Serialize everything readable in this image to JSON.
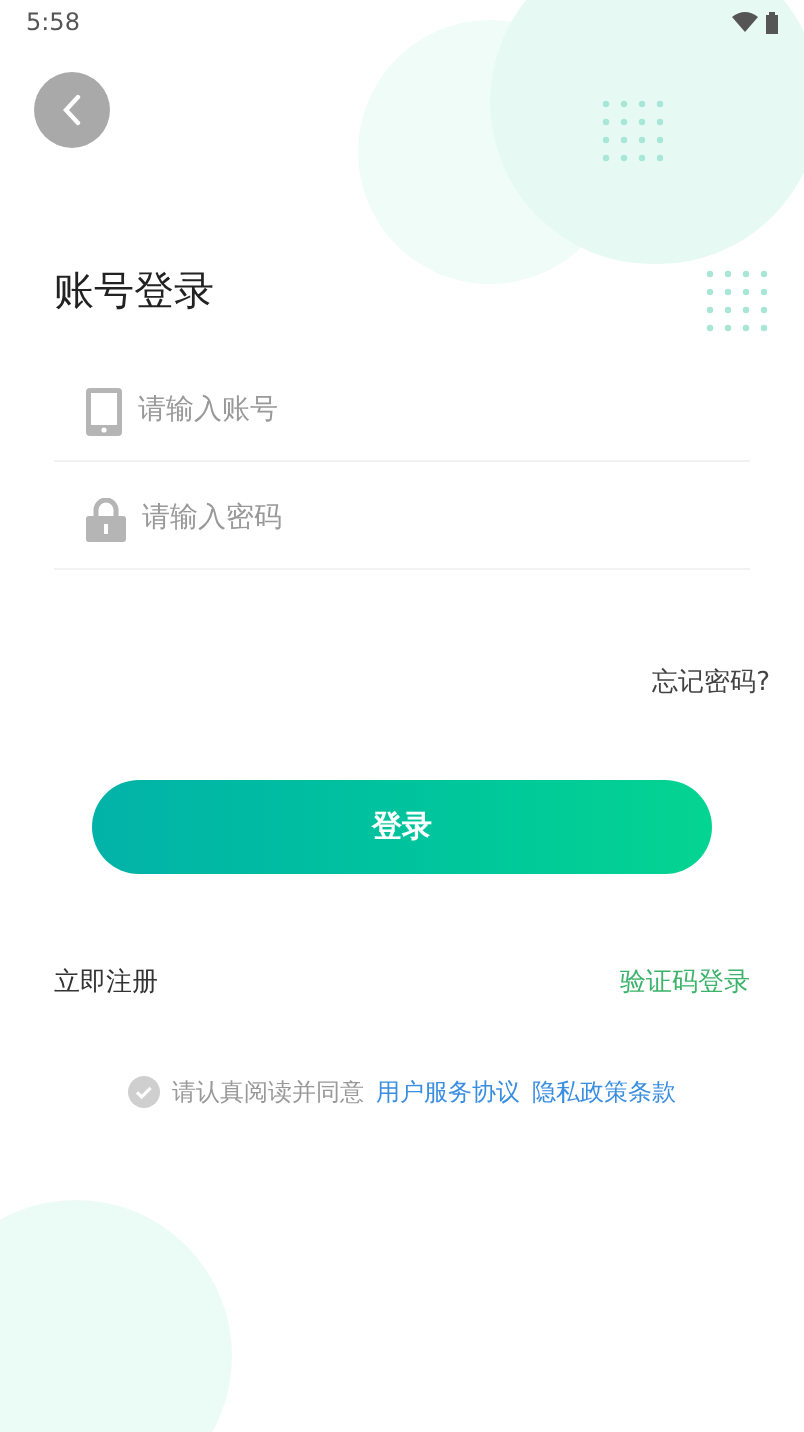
{
  "status_bar": {
    "time": "5:58"
  },
  "title": "账号登录",
  "fields": [
    {
      "kind": "phone",
      "placeholder": "请输入账号"
    },
    {
      "kind": "lock",
      "placeholder": "请输入密码"
    }
  ],
  "forgot_link": "忘记密码?",
  "login_button": "登录",
  "register_link": "立即注册",
  "sms_login_link": "验证码登录",
  "agreement": {
    "checked": false,
    "text": "请认真阅读并同意",
    "links": [
      "用户服务协议",
      "隐私政策条款"
    ]
  }
}
